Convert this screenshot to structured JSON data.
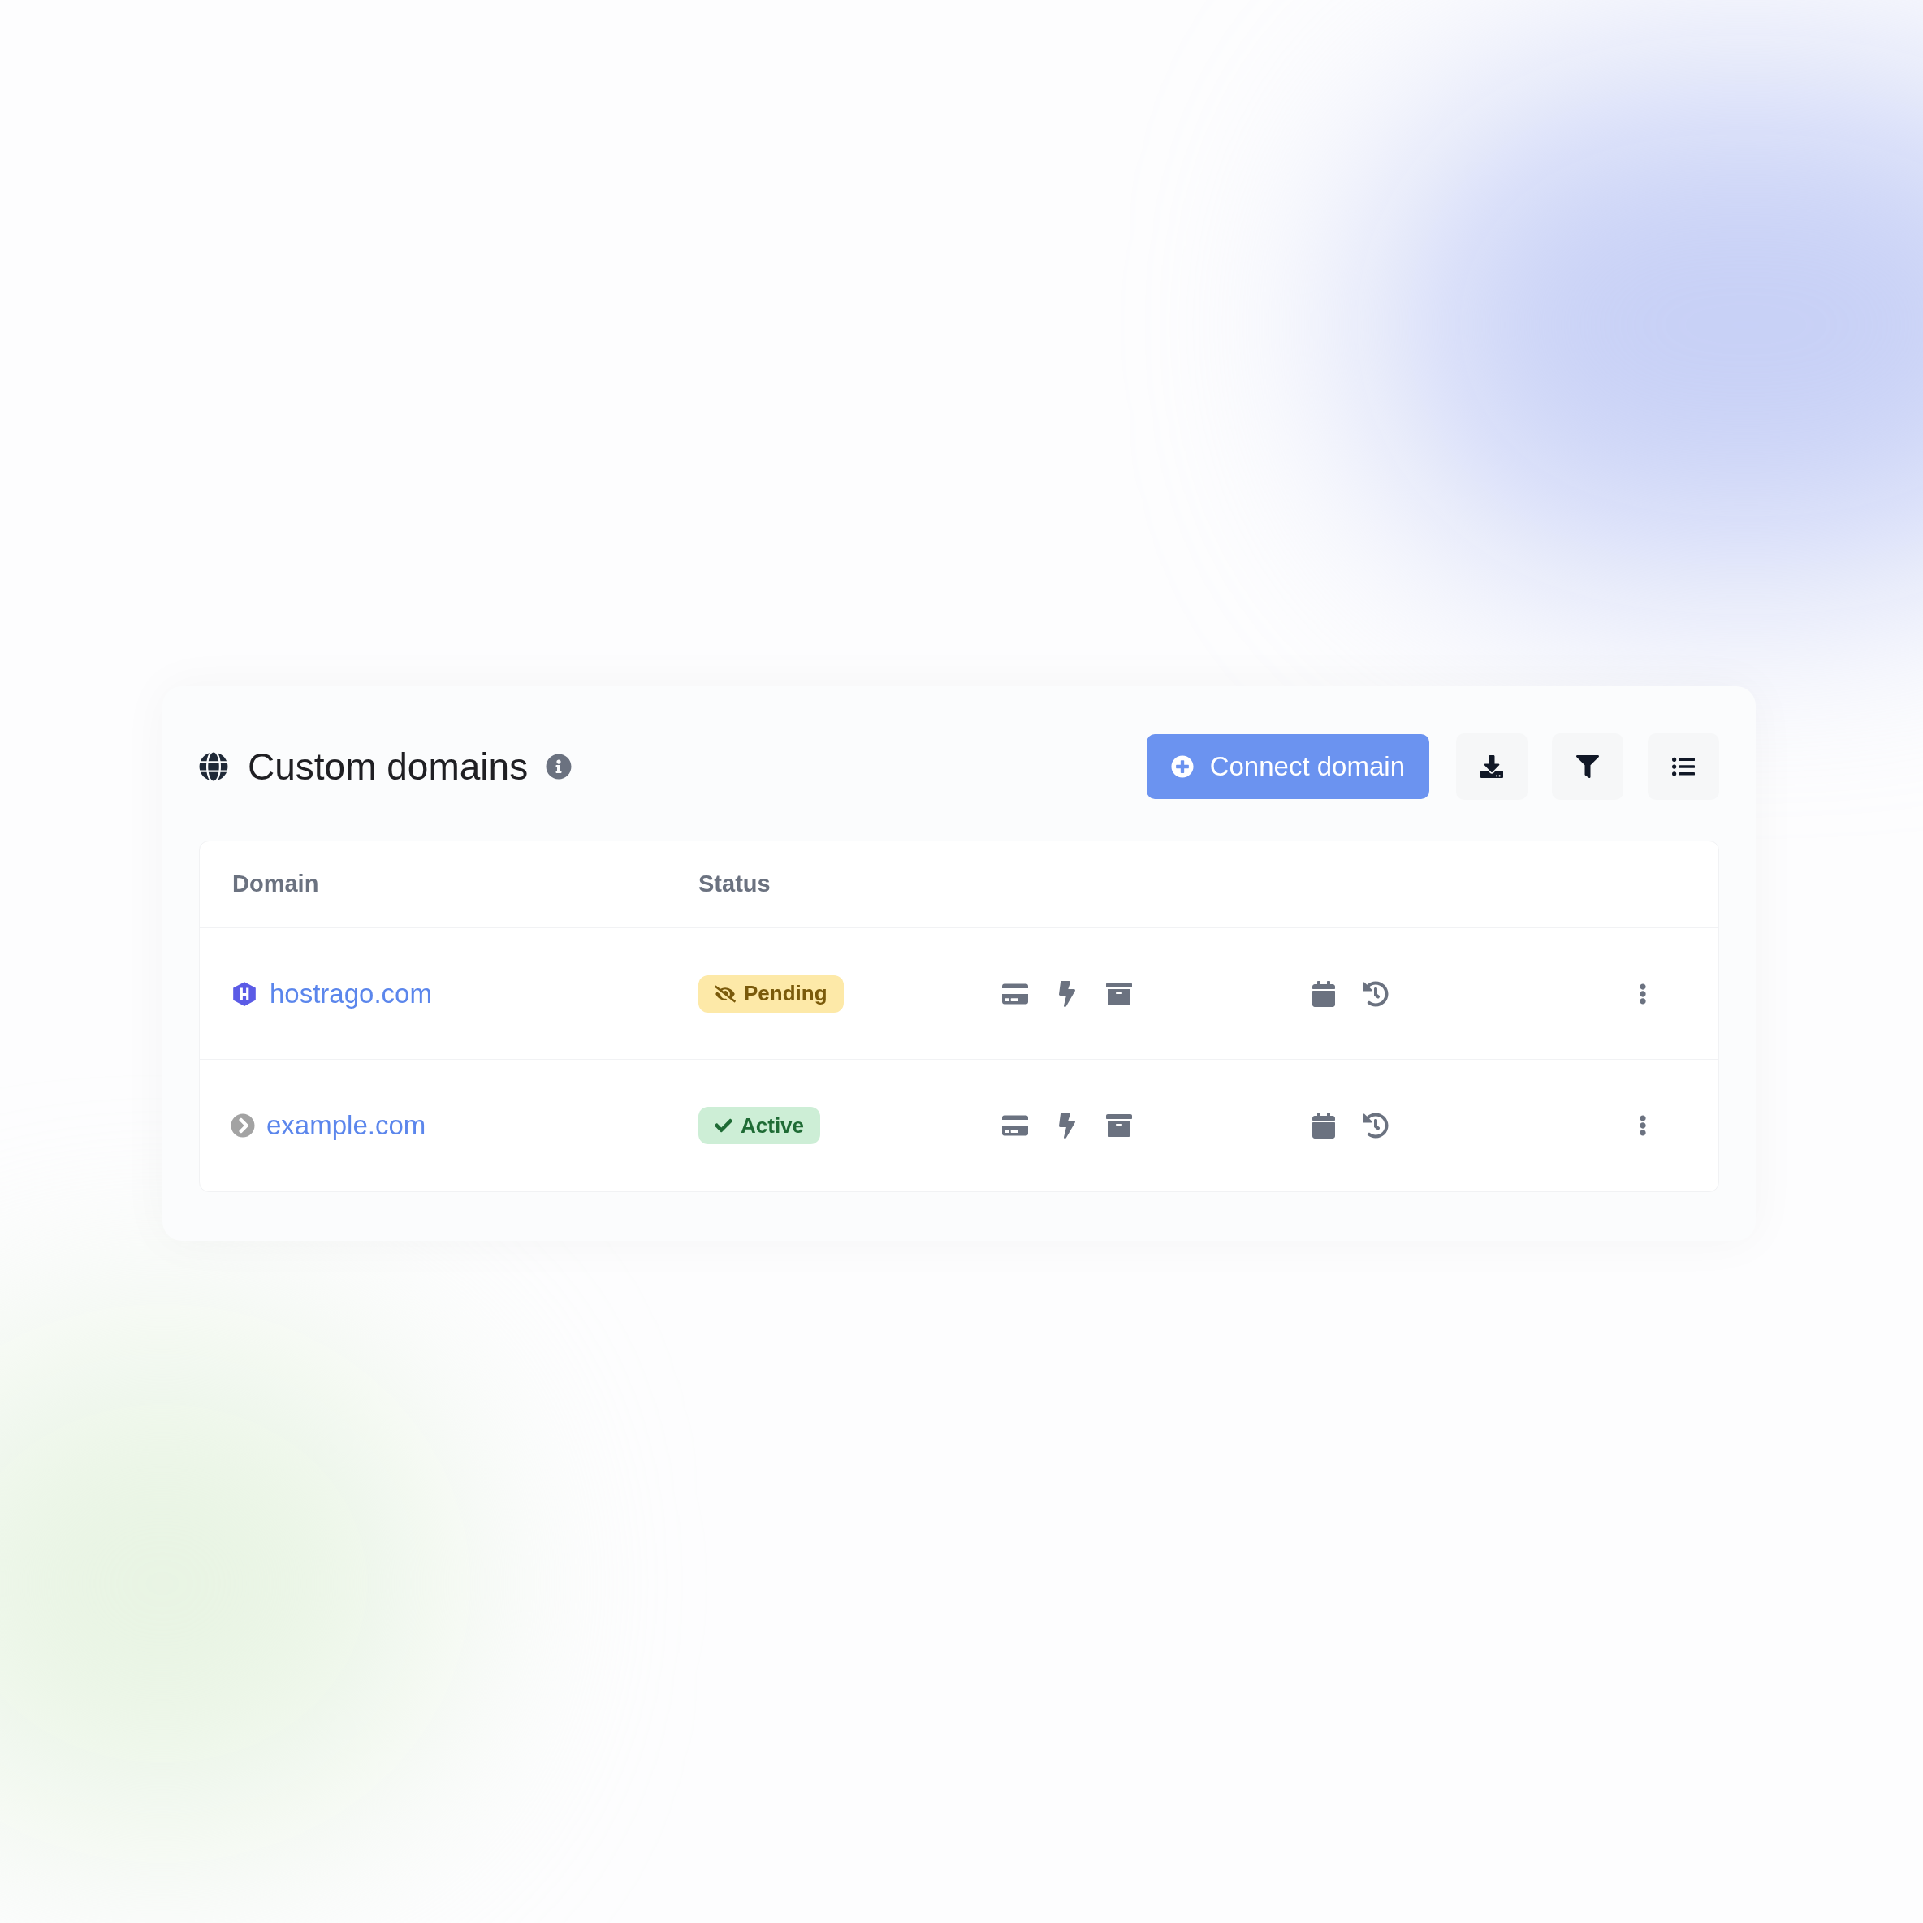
{
  "header": {
    "title": "Custom domains",
    "primary_button": "Connect domain"
  },
  "table": {
    "columns": [
      "Domain",
      "Status"
    ],
    "rows": [
      {
        "domain": "hostrago.com",
        "kind": "logo",
        "status": {
          "kind": "pending",
          "label": "Pending"
        }
      },
      {
        "domain": "example.com",
        "kind": "chevron",
        "status": {
          "kind": "active",
          "label": "Active"
        }
      }
    ]
  }
}
